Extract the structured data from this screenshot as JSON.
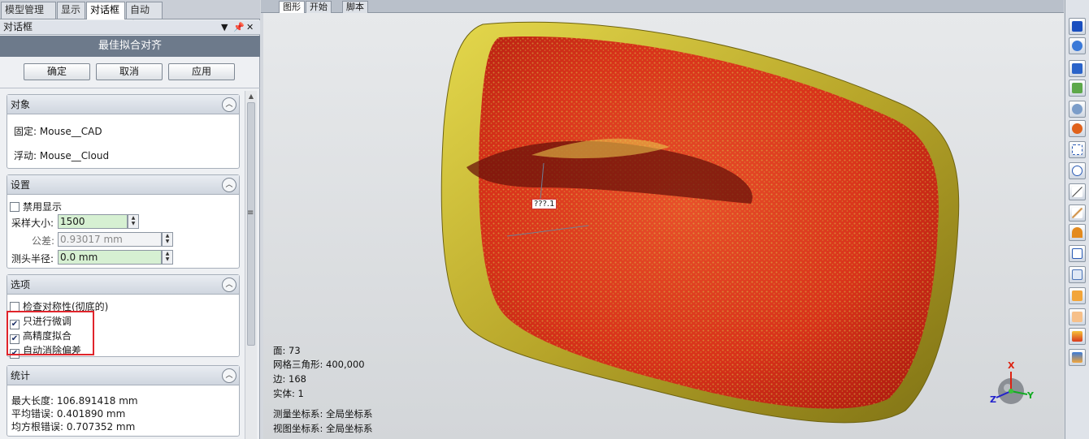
{
  "main_tabs": [
    {
      "label": "模型管理器"
    },
    {
      "label": "显示"
    },
    {
      "label": "对话框"
    },
    {
      "label": "自动化"
    }
  ],
  "dialog": {
    "header": "对话框",
    "title": "最佳拟合对齐",
    "buttons": {
      "ok": "确定",
      "cancel": "取消",
      "apply": "应用"
    },
    "header_controls": {
      "dropdown": "▼",
      "pin": "📌",
      "close": "✕"
    }
  },
  "groups": {
    "object": {
      "title": "对象",
      "fixed": "固定: Mouse__CAD",
      "floating": "浮动: Mouse__Cloud"
    },
    "settings": {
      "title": "设置",
      "disable_display": {
        "label": "禁用显示",
        "checked": false
      },
      "sample_size": {
        "label": "采样大小:",
        "value": "1500"
      },
      "tolerance": {
        "label": "公差:",
        "value": "0.93017 mm"
      },
      "probe_radius": {
        "label": "测头半径:",
        "value": "0.0 mm"
      }
    },
    "options": {
      "title": "选项",
      "check_symmetry": {
        "label": "检查对称性(彻底的)",
        "checked": false
      },
      "fine_tune_only": {
        "label": "只进行微调",
        "checked": true
      },
      "high_precision": {
        "label": "高精度拟合",
        "checked": true
      },
      "auto_eliminate_bias": {
        "label": "自动消除偏差",
        "checked": true
      }
    },
    "stats": {
      "title": "统计",
      "max_length": "最大长度: 106.891418 mm",
      "avg_error": "平均错误: 0.401890 mm",
      "rms_error": "均方根错误: 0.707352 mm"
    }
  },
  "viewport": {
    "tabs": [
      {
        "label": "图形"
      },
      {
        "label": "开始"
      },
      {
        "label": "脚本"
      }
    ],
    "annotation": "???.1",
    "info": {
      "faces": "面: 73",
      "mesh_triangles": "网格三角形: 400,000",
      "edges": "边: 168",
      "solids": "实体: 1",
      "measure_cs": "测量坐标系: 全局坐标系",
      "view_cs": "视图坐标系: 全局坐标系"
    },
    "axes": {
      "x": "X",
      "y": "Y",
      "z": "Z"
    }
  },
  "toolbar_icons": [
    "view-cube-icon",
    "rotate-icon",
    "view-front-icon",
    "pan-icon",
    "zoom-icon",
    "zoom-dynamic-icon",
    "zoom-box-icon",
    "zoom-fit-icon",
    "measure-icon",
    "tool-icon",
    "arc-icon",
    "select-box-icon",
    "select-lasso-icon",
    "arrow-icon",
    "direction-icon",
    "cube-color-icon",
    "color-map-icon"
  ],
  "colors": {
    "cad_model": "#c9b830",
    "point_cloud": "#e02a10",
    "highlight": "#e0242b",
    "title_bar": "#6d7a8b"
  }
}
